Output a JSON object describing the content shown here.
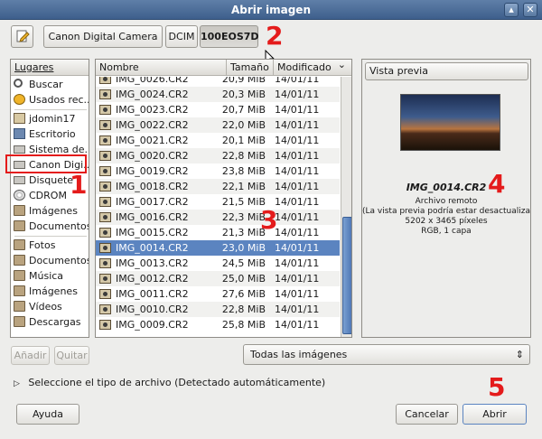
{
  "window": {
    "title": "Abrir imagen",
    "up_glyph": "▴",
    "close_glyph": "✕"
  },
  "breadcrumb": {
    "items": [
      "Canon Digital Camera",
      "DCIM",
      "100EOS7D"
    ]
  },
  "places": {
    "header": "Lugares",
    "items": [
      "Buscar",
      "Usados rec...",
      "jdomin17",
      "Escritorio",
      "Sistema de...",
      "Canon Digi...",
      "Disquete",
      "CDROM",
      "Imágenes",
      "Documentos",
      "Fotos",
      "Documentos",
      "Música",
      "Imágenes",
      "Vídeos",
      "Descargas"
    ],
    "add_label": "Añadir",
    "remove_label": "Quitar"
  },
  "files": {
    "columns": [
      "Nombre",
      "Tamaño",
      "Modificado"
    ],
    "sort_glyph": "⌄",
    "rows": [
      {
        "name": "IMG_0026.CR2",
        "size": "20,9 MiB",
        "date": "14/01/11"
      },
      {
        "name": "IMG_0024.CR2",
        "size": "20,3 MiB",
        "date": "14/01/11"
      },
      {
        "name": "IMG_0023.CR2",
        "size": "20,7 MiB",
        "date": "14/01/11"
      },
      {
        "name": "IMG_0022.CR2",
        "size": "22,0 MiB",
        "date": "14/01/11"
      },
      {
        "name": "IMG_0021.CR2",
        "size": "20,1 MiB",
        "date": "14/01/11"
      },
      {
        "name": "IMG_0020.CR2",
        "size": "22,8 MiB",
        "date": "14/01/11"
      },
      {
        "name": "IMG_0019.CR2",
        "size": "23,8 MiB",
        "date": "14/01/11"
      },
      {
        "name": "IMG_0018.CR2",
        "size": "22,1 MiB",
        "date": "14/01/11"
      },
      {
        "name": "IMG_0017.CR2",
        "size": "21,5 MiB",
        "date": "14/01/11"
      },
      {
        "name": "IMG_0016.CR2",
        "size": "22,3 MiB",
        "date": "14/01/11"
      },
      {
        "name": "IMG_0015.CR2",
        "size": "21,3 MiB",
        "date": "14/01/11"
      },
      {
        "name": "IMG_0014.CR2",
        "size": "23,0 MiB",
        "date": "14/01/11"
      },
      {
        "name": "IMG_0013.CR2",
        "size": "24,5 MiB",
        "date": "14/01/11"
      },
      {
        "name": "IMG_0012.CR2",
        "size": "25,0 MiB",
        "date": "14/01/11"
      },
      {
        "name": "IMG_0011.CR2",
        "size": "27,6 MiB",
        "date": "14/01/11"
      },
      {
        "name": "IMG_0010.CR2",
        "size": "22,8 MiB",
        "date": "14/01/11"
      },
      {
        "name": "IMG_0009.CR2",
        "size": "25,8 MiB",
        "date": "14/01/11"
      }
    ]
  },
  "preview": {
    "header": "Vista previa",
    "filename": "IMG_0014.CR2",
    "line1": "Archivo remoto",
    "line2": "(La vista previa podría estar desactualizada)",
    "line3": "5202 x 3465 píxeles",
    "line4": "RGB, 1 capa"
  },
  "filter": {
    "selected": "Todas las imágenes",
    "glyph": "⇕"
  },
  "filetype": {
    "label": "Seleccione el tipo de archivo (Detectado automáticamente)",
    "glyph": "▷"
  },
  "buttons": {
    "help": "Ayuda",
    "cancel": "Cancelar",
    "open": "Abrir"
  },
  "annotations": [
    "1",
    "2",
    "3",
    "4",
    "5"
  ],
  "colors": {
    "annotation": "#e41b1b",
    "selection": "#5b84c0"
  }
}
